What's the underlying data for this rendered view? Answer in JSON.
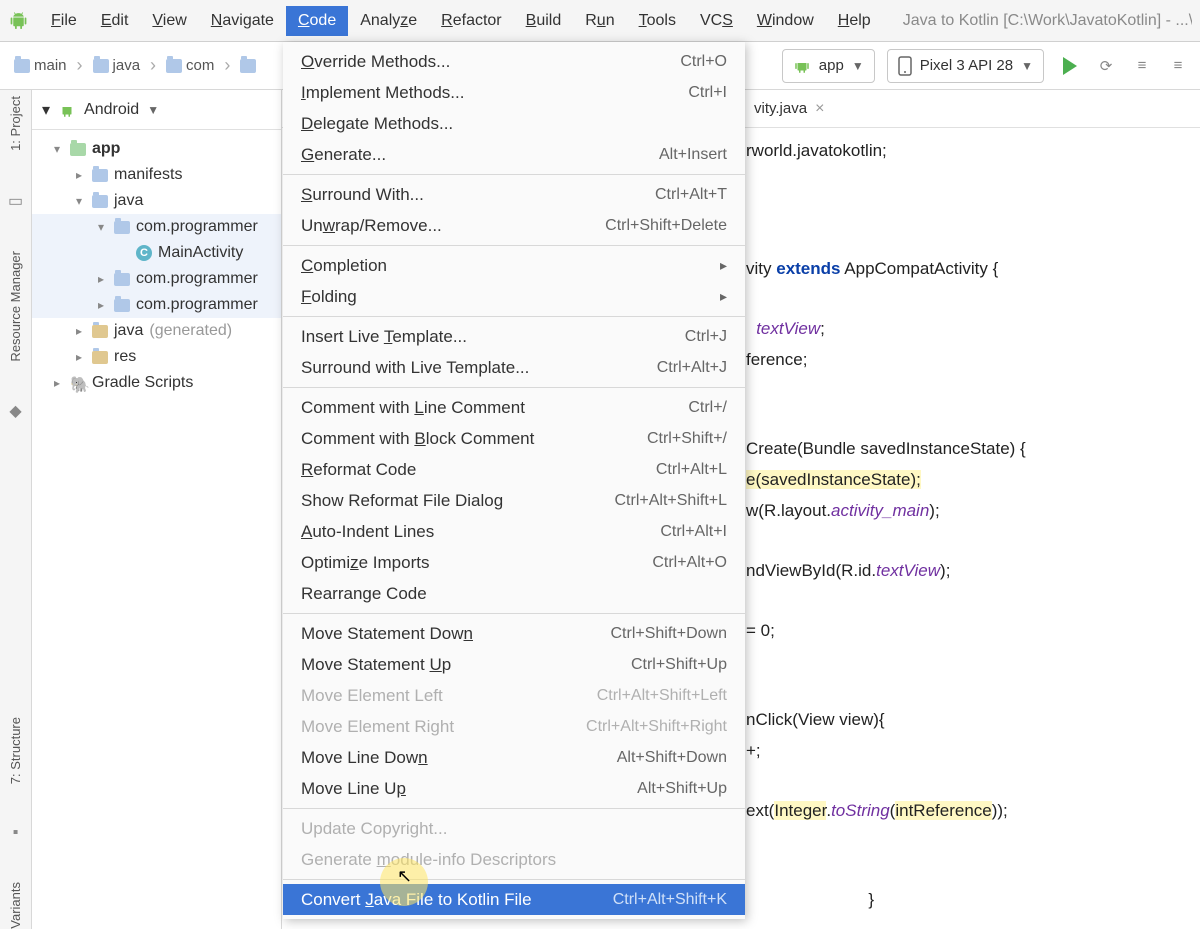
{
  "menubar": {
    "items": [
      "File",
      "Edit",
      "View",
      "Navigate",
      "Code",
      "Analyze",
      "Refactor",
      "Build",
      "Run",
      "Tools",
      "VCS",
      "Window",
      "Help"
    ],
    "active": "Code",
    "title": "Java to Kotlin [C:\\Work\\JavatoKotlin] - ...\\ja"
  },
  "breadcrumbs": [
    "main",
    "java",
    "com"
  ],
  "toolbar": {
    "app": "app",
    "device": "Pixel 3 API 28"
  },
  "leftRail": {
    "project": "1: Project",
    "resource": "Resource Manager",
    "structure": "7: Structure",
    "variants": "Variants"
  },
  "panel": {
    "header": "Android"
  },
  "tree": {
    "app": "app",
    "manifests": "manifests",
    "java": "java",
    "pkg1": "com.programmer",
    "main_activity": "MainActivity",
    "pkg2": "com.programmer",
    "pkg3": "com.programmer",
    "java_gen": "java",
    "gen": "(generated)",
    "res": "res",
    "gradle": "Gradle Scripts"
  },
  "editor": {
    "tab": "vity.java"
  },
  "code": {
    "l1a": "rworld.javatokotlin;",
    "l2a": "vity ",
    "l2b": "extends",
    "l2c": " AppCompatActivity {",
    "l3a": "textView",
    "l3b": ";",
    "l4a": "ference;",
    "l5a": "Create(Bundle savedInstanceState) {",
    "l6a": "e(savedInstanceState);",
    "l7a": "w(R.layout.",
    "l7b": "activity_main",
    "l7c": ");",
    "l8a": "ndViewById(R.id.",
    "l8b": "textView",
    "l8c": ");",
    "l9a": "= 0;",
    "l10a": "nClick(View view){",
    "l11a": "+;",
    "l12a": "ext(",
    "l12b": "Integer",
    "l12c": ".",
    "l12d": "toString",
    "l12e": "(",
    "l12f": "intReference",
    "l12g": "));",
    "l13a": "}"
  },
  "menu": {
    "override": {
      "l": "Override Methods...",
      "r": "Ctrl+O"
    },
    "implement": {
      "l": "Implement Methods...",
      "r": "Ctrl+I"
    },
    "delegate": {
      "l": "Delegate Methods..."
    },
    "generate": {
      "l": "Generate...",
      "r": "Alt+Insert"
    },
    "surround": {
      "l": "Surround With...",
      "r": "Ctrl+Alt+T"
    },
    "unwrap": {
      "l": "Unwrap/Remove...",
      "r": "Ctrl+Shift+Delete"
    },
    "completion": {
      "l": "Completion"
    },
    "folding": {
      "l": "Folding"
    },
    "insert_template": {
      "l": "Insert Live Template...",
      "r": "Ctrl+J"
    },
    "surround_template": {
      "l": "Surround with Live Template...",
      "r": "Ctrl+Alt+J"
    },
    "comment_line": {
      "l": "Comment with Line Comment",
      "r": "Ctrl+/"
    },
    "comment_block": {
      "l": "Comment with Block Comment",
      "r": "Ctrl+Shift+/"
    },
    "reformat": {
      "l": "Reformat Code",
      "r": "Ctrl+Alt+L"
    },
    "reformat_dialog": {
      "l": "Show Reformat File Dialog",
      "r": "Ctrl+Alt+Shift+L"
    },
    "auto_indent": {
      "l": "Auto-Indent Lines",
      "r": "Ctrl+Alt+I"
    },
    "optimize": {
      "l": "Optimize Imports",
      "r": "Ctrl+Alt+O"
    },
    "rearrange": {
      "l": "Rearrange Code"
    },
    "stmt_down": {
      "l": "Move Statement Down",
      "r": "Ctrl+Shift+Down"
    },
    "stmt_up": {
      "l": "Move Statement Up",
      "r": "Ctrl+Shift+Up"
    },
    "elem_left": {
      "l": "Move Element Left",
      "r": "Ctrl+Alt+Shift+Left"
    },
    "elem_right": {
      "l": "Move Element Right",
      "r": "Ctrl+Alt+Shift+Right"
    },
    "line_down": {
      "l": "Move Line Down",
      "r": "Alt+Shift+Down"
    },
    "line_up": {
      "l": "Move Line Up",
      "r": "Alt+Shift+Up"
    },
    "copyright": {
      "l": "Update Copyright..."
    },
    "moduleinfo": {
      "l": "Generate module-info Descriptors"
    },
    "convert": {
      "l": "Convert Java File to Kotlin File",
      "r": "Ctrl+Alt+Shift+K"
    }
  }
}
